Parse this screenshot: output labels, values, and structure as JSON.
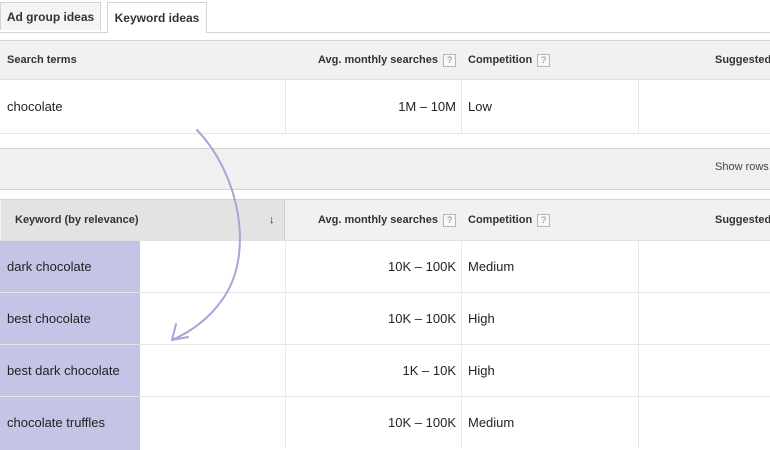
{
  "tabs": [
    {
      "label": "Ad group ideas"
    },
    {
      "label": "Keyword ideas"
    }
  ],
  "search_table": {
    "headers": {
      "term": "Search terms",
      "avg": "Avg. monthly searches",
      "competition": "Competition",
      "suggested": "Suggested"
    },
    "rows": [
      {
        "term": "chocolate",
        "avg": "1M – 10M",
        "competition": "Low"
      }
    ]
  },
  "band": {
    "show_rows": "Show rows"
  },
  "keyword_table": {
    "headers": {
      "keyword": "Keyword (by relevance)",
      "avg": "Avg. monthly searches",
      "competition": "Competition",
      "suggested": "Suggested"
    },
    "help_glyph": "?",
    "sort_glyph": "↓",
    "rows": [
      {
        "keyword": "dark chocolate",
        "avg": "10K – 100K",
        "competition": "Medium"
      },
      {
        "keyword": "best chocolate",
        "avg": "10K – 100K",
        "competition": "High"
      },
      {
        "keyword": "best dark chocolate",
        "avg": "1K – 10K",
        "competition": "High"
      },
      {
        "keyword": "chocolate truffles",
        "avg": "10K – 100K",
        "competition": "Medium"
      }
    ]
  },
  "colors": {
    "highlight": "#c5c3e6",
    "arrow": "#a9a6d6"
  }
}
